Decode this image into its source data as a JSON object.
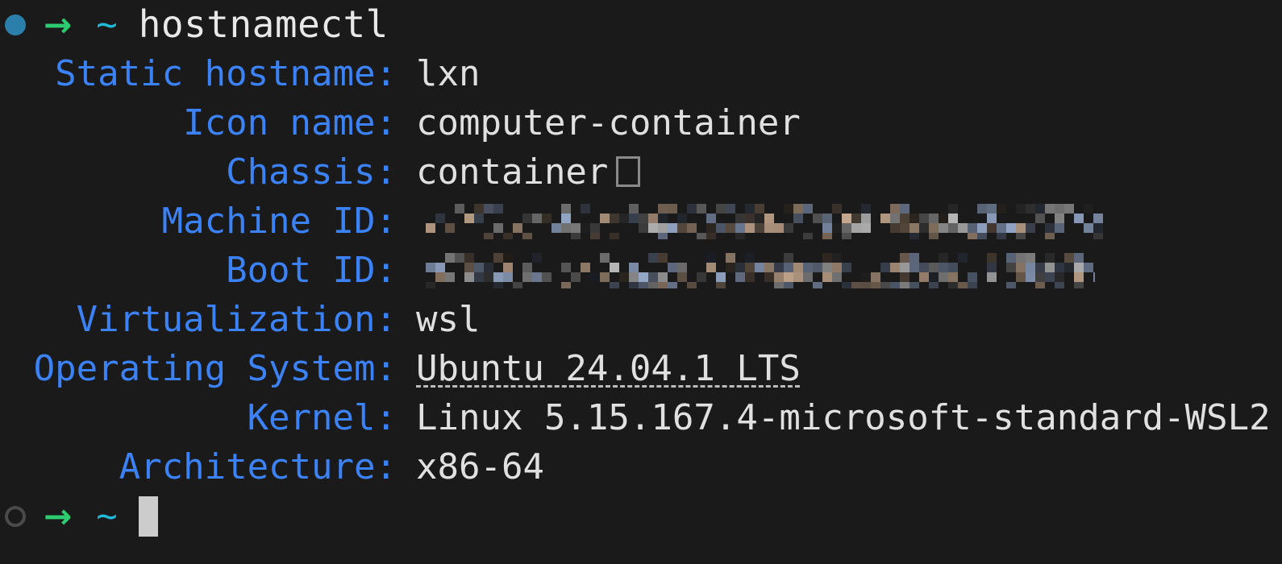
{
  "terminal": {
    "background_color": "#1a1a1a",
    "foreground_color": "#e0e0e0",
    "label_color": "#3b82f6",
    "accent_green": "#2ecc71",
    "accent_cyan": "#22b8d8",
    "accent_teal": "#2a80ab",
    "cursor_color": "#cccccc"
  },
  "command_line": {
    "status_icon": "filled-circle-icon",
    "arrow_icon": "→",
    "cwd": "~",
    "command": "hostnamectl"
  },
  "output": {
    "rows": [
      {
        "label": "Static hostname:",
        "value": "lxn",
        "kind": "text"
      },
      {
        "label": "Icon name:",
        "value": "computer-container",
        "kind": "text"
      },
      {
        "label": "Chassis:",
        "value": "container",
        "kind": "text-with-tofu"
      },
      {
        "label": "Machine ID:",
        "value": "",
        "kind": "redacted",
        "redacted_width": 852
      },
      {
        "label": "Boot ID:",
        "value": "",
        "kind": "redacted",
        "redacted_width": 842
      },
      {
        "label": "Virtualization:",
        "value": "wsl",
        "kind": "text"
      },
      {
        "label": "Operating System:",
        "value": "Ubuntu 24.04.1 LTS",
        "kind": "link"
      },
      {
        "label": "Kernel:",
        "value": "Linux 5.15.167.4-microsoft-standard-WSL2",
        "kind": "text"
      },
      {
        "label": "Architecture:",
        "value": "x86-64",
        "kind": "text"
      }
    ]
  },
  "next_prompt": {
    "status_icon": "hollow-circle-icon",
    "arrow_icon": "→",
    "cwd": "~",
    "input": ""
  }
}
